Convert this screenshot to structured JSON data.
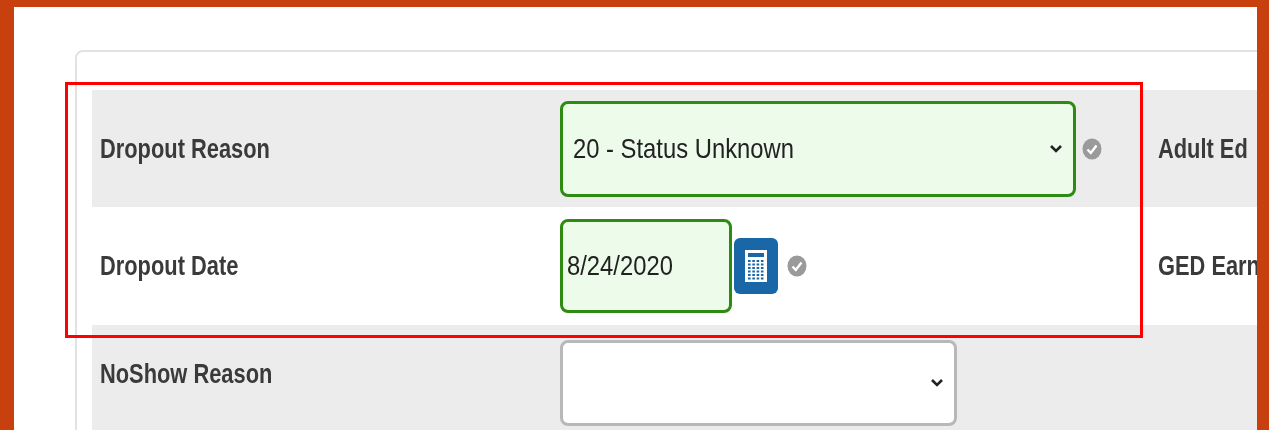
{
  "rows": [
    {
      "label": "Dropout Reason",
      "field": {
        "kind": "select",
        "value": "20 - Status Unknown",
        "valid": true
      },
      "shaded": true,
      "right_label": "Adult Ed"
    },
    {
      "label": "Dropout Date",
      "field": {
        "kind": "date",
        "value": "8/24/2020",
        "valid": true
      },
      "shaded": false,
      "right_label": "GED Earn"
    },
    {
      "label": "NoShow Reason",
      "field": {
        "kind": "select",
        "valid": false
      },
      "shaded": true
    }
  ],
  "highlight_box": {
    "shown": true
  }
}
